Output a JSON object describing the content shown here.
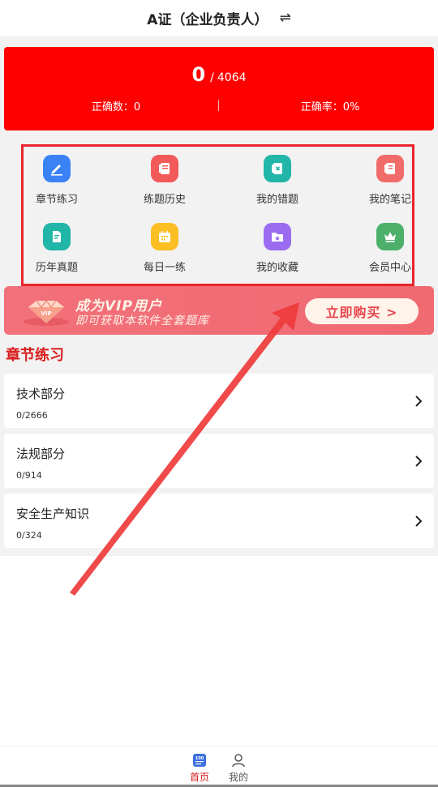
{
  "header": {
    "title": "A证（企业负责人）",
    "swap_icon": "⇌"
  },
  "score": {
    "done": "0",
    "separator": "/",
    "total": "4064",
    "correct_count": "正确数：0",
    "correct_rate": "正确率：0%"
  },
  "grid": {
    "items": [
      {
        "label": "章节练习",
        "icon": "pen-icon",
        "color": "#3b82f6"
      },
      {
        "label": "练题历史",
        "icon": "history-icon",
        "color": "#f25a5a"
      },
      {
        "label": "我的错题",
        "icon": "wrong-notebook-icon",
        "color": "#21b6a8"
      },
      {
        "label": "我的笔记",
        "icon": "notebook-icon",
        "color": "#f26b6b"
      },
      {
        "label": "历年真题",
        "icon": "document-icon",
        "color": "#21b6a8"
      },
      {
        "label": "每日一练",
        "icon": "calendar-icon",
        "color": "#fbbf24"
      },
      {
        "label": "我的收藏",
        "icon": "favorite-folder-icon",
        "color": "#9b6cf0"
      },
      {
        "label": "会员中心",
        "icon": "crown-icon",
        "color": "#4caf6a"
      }
    ]
  },
  "vip": {
    "title": "成为VIP用户",
    "subtitle": "即可获取本软件全套题库",
    "button": "立即购买 >"
  },
  "section": {
    "title": "章节练习"
  },
  "chapters": [
    {
      "name": "技术部分",
      "count": "0/2666"
    },
    {
      "name": "法规部分",
      "count": "0/914"
    },
    {
      "name": "安全生产知识",
      "count": "0/324"
    }
  ],
  "nav": {
    "home": "首页",
    "mine": "我的",
    "home_icon_text": "100",
    "active_color": "#d91c1c"
  }
}
